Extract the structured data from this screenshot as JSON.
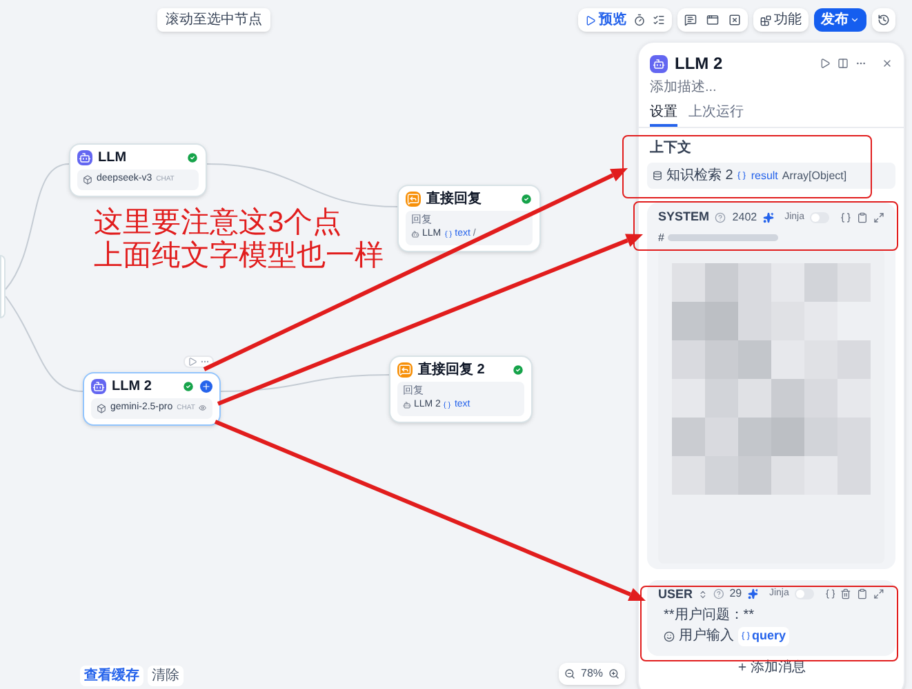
{
  "toolbar": {
    "tooltip": "滚动至选中节点",
    "preview": "预览",
    "features": "功能",
    "publish": "发布"
  },
  "nodes": [
    {
      "kind": "llm",
      "title": "LLM",
      "model": "deepseek-v3",
      "mode": "CHAT",
      "done": true,
      "selected": false
    },
    {
      "kind": "answer",
      "title": "直接回复",
      "reply_label": "回复",
      "source": "LLM",
      "variable": "text",
      "suffix": "/",
      "done": true,
      "selected": false
    },
    {
      "kind": "llm",
      "title": "LLM 2",
      "model": "gemini-2.5-pro",
      "mode": "CHAT",
      "done": true,
      "selected": true
    },
    {
      "kind": "answer",
      "title": "直接回复 2",
      "reply_label": "回复",
      "source": "LLM 2",
      "variable": "text",
      "done": true,
      "selected": false
    }
  ],
  "annotation": {
    "lines": [
      "这里要注意这3个点",
      "上面纯文字模型也一样"
    ]
  },
  "cache": {
    "view": "查看缓存",
    "clear": "清除"
  },
  "zoom": "78%",
  "panel": {
    "title": "LLM 2",
    "description_placeholder": "添加描述...",
    "tabs": [
      {
        "label": "设置",
        "selected": true
      },
      {
        "label": "上次运行",
        "selected": false
      }
    ],
    "context": {
      "label": "上下文",
      "source": "知识检索 2",
      "variable": "result",
      "type": "Array[Object]"
    },
    "messages": [
      {
        "kind": "blurred",
        "role": "SYSTEM",
        "tokens": "2402",
        "jinja_label": "Jinja",
        "jinja": false,
        "heading_mark": "#"
      },
      {
        "kind": "text",
        "role": "USER",
        "tokens": "29",
        "jinja_label": "Jinja",
        "jinja": false,
        "line": "**用户问题：**",
        "input_label": "用户输入",
        "input_variable": "query"
      }
    ],
    "add_message": "添加消息"
  }
}
